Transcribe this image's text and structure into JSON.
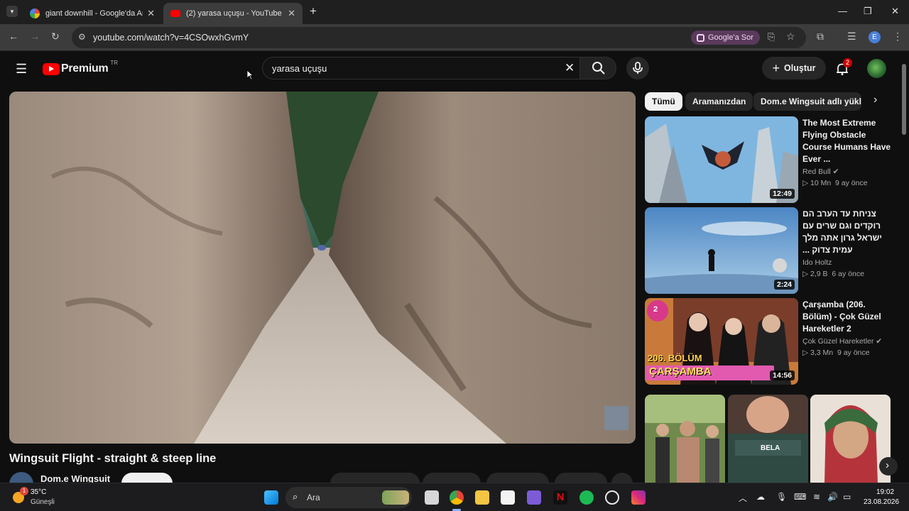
{
  "browser": {
    "tabs": [
      {
        "title": "giant downhill - Google'da Ara",
        "close": "✕"
      },
      {
        "title": "(2) yarasa uçuşu - YouTube",
        "close": "✕"
      }
    ],
    "new_tab": "+",
    "url": "youtube.com/watch?v=4CSOwxhGvmY",
    "google_sor": "Google'a Sor",
    "profile_initial": "E"
  },
  "youtube": {
    "logo_text": "Premium",
    "region": "TR",
    "search_value": "yarasa uçuşu",
    "create_label": "Oluştur",
    "notifications": "2",
    "video": {
      "title": "Wingsuit Flight - straight & steep line",
      "channel": "Dom.e Wingsuit"
    },
    "chips": [
      "Tümü",
      "Aramanızdan",
      "Dom.e Wingsuit adlı yükley"
    ],
    "recommendations": [
      {
        "title": "The Most Extreme Flying Obstacle Course Humans Have Ever ...",
        "channel": "Red Bull",
        "verified": true,
        "views": "10 Mn",
        "age": "9 ay önce",
        "duration": "12:49"
      },
      {
        "title": "צניחת עד הערב הם רוקדים וגם שרים עם ישראל גרון אתה מלך עמית צדוק ...",
        "channel": "Ido Holtz",
        "verified": false,
        "views": "2,9 B",
        "age": "6 ay önce",
        "duration": "2:24"
      },
      {
        "title": "Çarşamba (206. Bölüm) - Çok Güzel Hareketler 2",
        "channel": "Çok Güzel Hareketler",
        "verified": true,
        "views": "3,3 Mn",
        "age": "9 ay önce",
        "duration": "14:56",
        "thumb_text_1": "206. BÖLÜM",
        "thumb_text_2": "ÇARŞAMBA",
        "thumb_badge": "2"
      }
    ],
    "shorts_overlay": "BELA"
  },
  "taskbar": {
    "weather_temp": "35°C",
    "weather_desc": "Güneşli",
    "weather_badge": "1",
    "search_placeholder": "Ara",
    "time": "19:02",
    "date": "23.08.2026"
  }
}
